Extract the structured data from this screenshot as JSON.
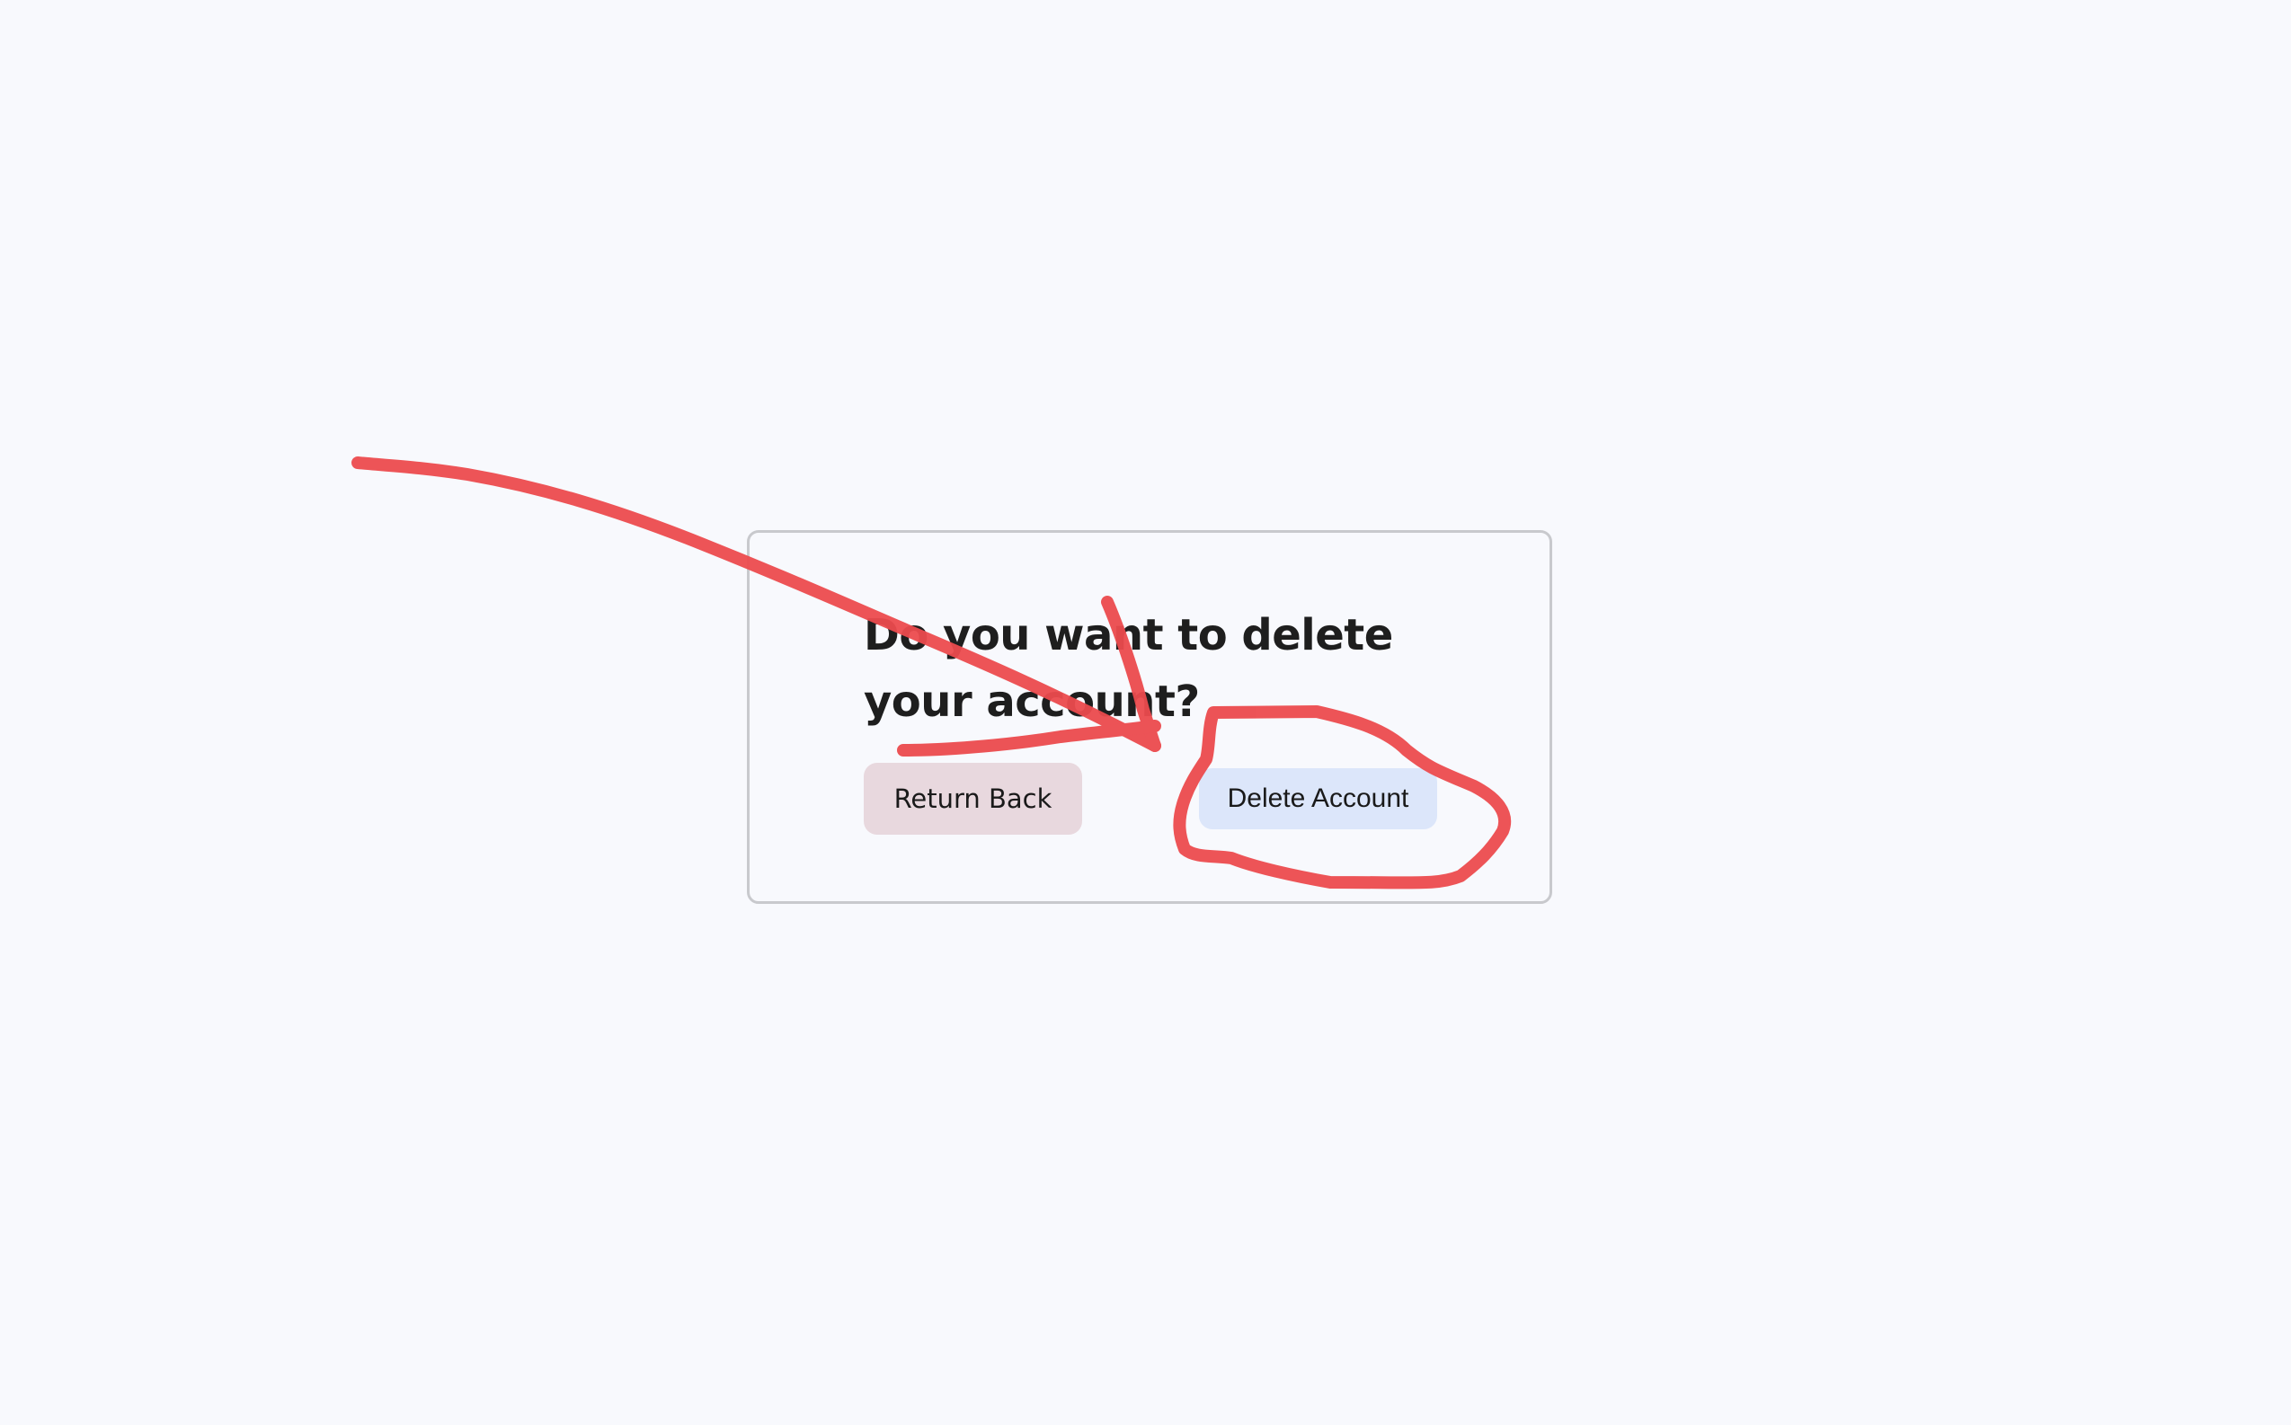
{
  "dialog": {
    "title_line1": "Do you want to delete",
    "title_line2": "your account?",
    "return_label": "Return Back",
    "delete_label": "Delete Account"
  },
  "colors": {
    "background": "#f8f9fd",
    "dialog_border": "#c8c9cd",
    "return_button": "#e8d8de",
    "delete_button": "#dce6fa",
    "annotation": "#ec4b4e"
  }
}
